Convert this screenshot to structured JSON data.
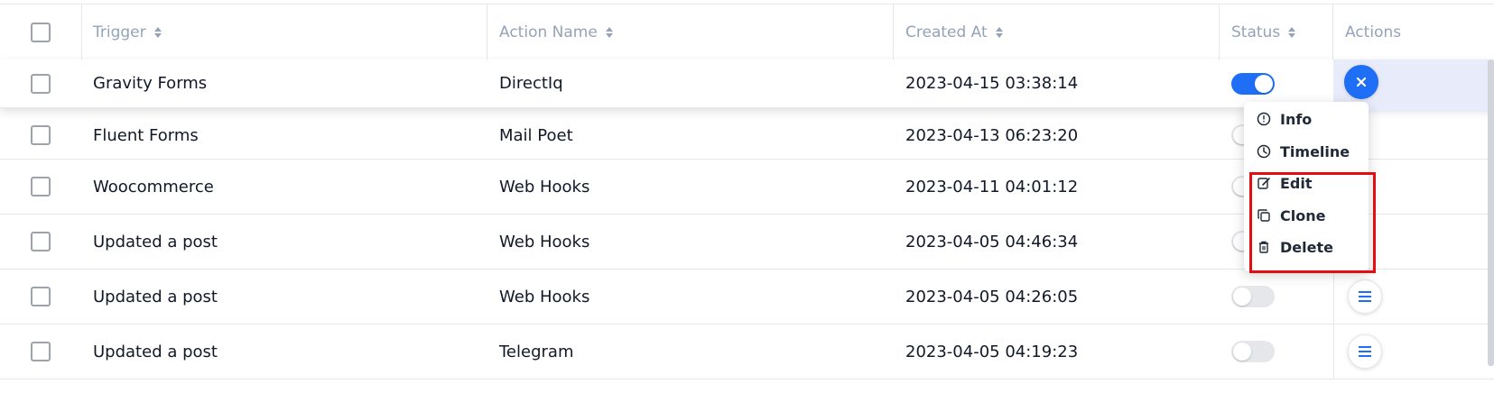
{
  "header": {
    "trigger": "Trigger",
    "action_name": "Action Name",
    "created_at": "Created At",
    "status": "Status",
    "actions": "Actions"
  },
  "rows": [
    {
      "trigger": "Gravity Forms",
      "action_name": "DirectIq",
      "created_at": "2023-04-15 03:38:14",
      "status": "on"
    },
    {
      "trigger": "Fluent Forms",
      "action_name": "Mail Poet",
      "created_at": "2023-04-13 06:23:20",
      "status": "off"
    },
    {
      "trigger": "Woocommerce",
      "action_name": "Web Hooks",
      "created_at": "2023-04-11 04:01:12",
      "status": "off"
    },
    {
      "trigger": "Updated a post",
      "action_name": "Web Hooks",
      "created_at": "2023-04-05 04:46:34",
      "status": "off"
    },
    {
      "trigger": "Updated a post",
      "action_name": "Web Hooks",
      "created_at": "2023-04-05 04:26:05",
      "status": "off"
    },
    {
      "trigger": "Updated a post",
      "action_name": "Telegram",
      "created_at": "2023-04-05 04:19:23",
      "status": "off"
    }
  ],
  "menu": {
    "info": "Info",
    "timeline": "Timeline",
    "edit": "Edit",
    "clone": "Clone",
    "delete": "Delete"
  },
  "colors": {
    "accent": "#1e6ff5",
    "highlight": "#e30d12"
  }
}
